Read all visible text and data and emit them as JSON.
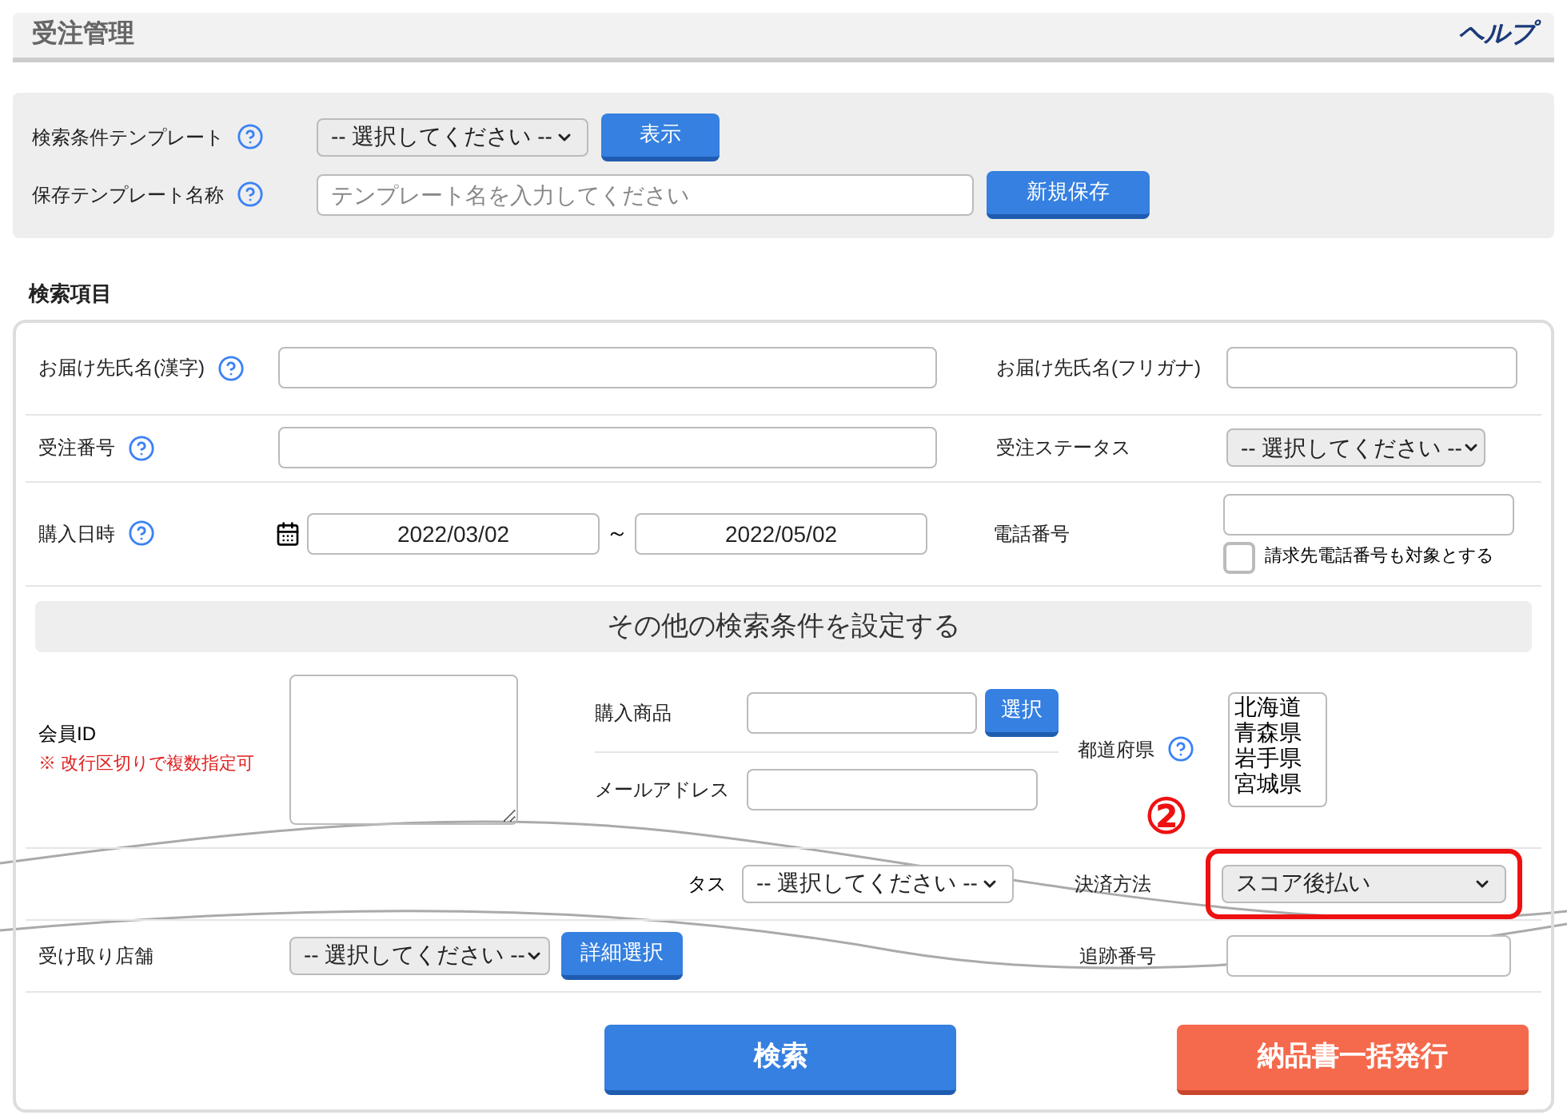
{
  "header": {
    "title": "受注管理",
    "help": "ヘルプ"
  },
  "template": {
    "select_label": "検索条件テンプレート",
    "select_value": "-- 選択してください --",
    "show_button": "表示",
    "name_label": "保存テンプレート名称",
    "name_placeholder": "テンプレート名を入力してください",
    "save_button": "新規保存"
  },
  "section_title": "検索項目",
  "fields": {
    "recipient_kanji": {
      "label": "お届け先氏名(漢字)",
      "help": true
    },
    "recipient_kana": {
      "label": "お届け先氏名(フリガナ)"
    },
    "order_number": {
      "label": "受注番号",
      "help": true
    },
    "order_status": {
      "label": "受注ステータス",
      "value": "-- 選択してください --"
    },
    "purchase_date": {
      "label": "購入日時",
      "help": true,
      "from": "2022/03/02",
      "separator": "～",
      "to": "2022/05/02"
    },
    "phone": {
      "label": "電話番号",
      "checkbox_label": "請求先電話番号も対象とする",
      "checked": false
    }
  },
  "more_banner": "その他の検索条件を設定する",
  "member": {
    "label": "会員ID",
    "note": "※ 改行区切りで複数指定可"
  },
  "product": {
    "label": "購入商品",
    "button": "選択"
  },
  "email": {
    "label": "メールアドレス"
  },
  "prefecture": {
    "label": "都道府県",
    "help": true,
    "options": [
      "北海道",
      "青森県",
      "岩手県",
      "宮城県"
    ]
  },
  "status_partial": {
    "label": "タス",
    "value": "-- 選択してください --"
  },
  "payment": {
    "label": "決済方法",
    "value": "スコア後払い",
    "highlighted": true,
    "marker": "②"
  },
  "store": {
    "label": "受け取り店舗",
    "value": "-- 選択してください --",
    "button": "詳細選択"
  },
  "tracking": {
    "label": "追跡番号"
  },
  "buttons": {
    "search": "検索",
    "invoice": "納品書一括発行"
  }
}
